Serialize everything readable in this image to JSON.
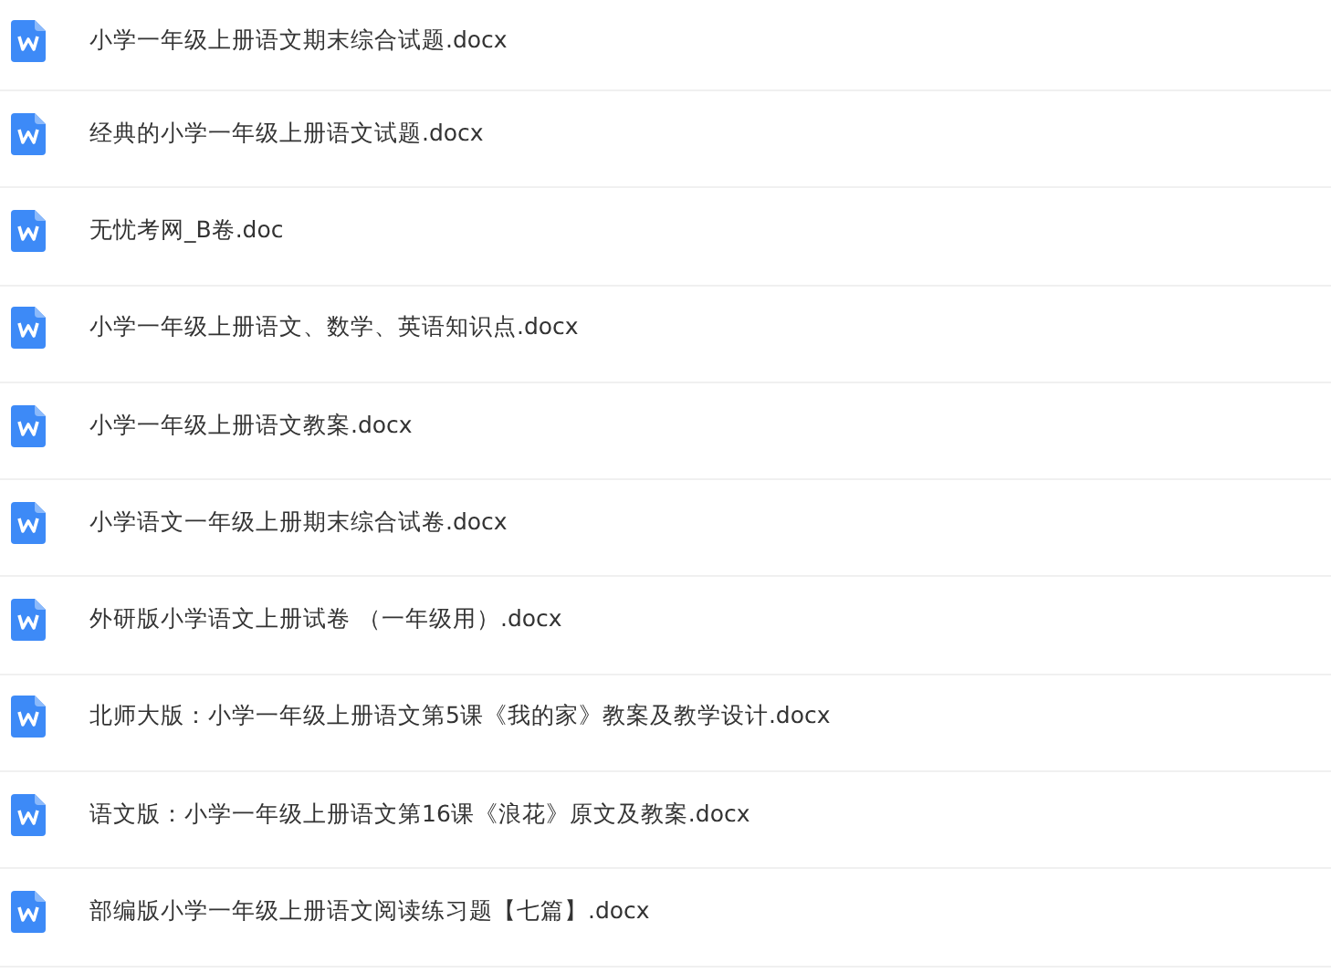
{
  "files": [
    {
      "name": "小学一年级上册语文期末综合试题.docx"
    },
    {
      "name": "经典的小学一年级上册语文试题.docx"
    },
    {
      "name": "无忧考网_B卷.doc"
    },
    {
      "name": "小学一年级上册语文、数学、英语知识点.docx"
    },
    {
      "name": "小学一年级上册语文教案.docx"
    },
    {
      "name": "小学语文一年级上册期末综合试卷.docx"
    },
    {
      "name": "外研版小学语文上册试卷 （一年级用）.docx"
    },
    {
      "name": "北师大版：小学一年级上册语文第5课《我的家》教案及教学设计.docx"
    },
    {
      "name": "语文版：小学一年级上册语文第16课《浪花》原文及教案.docx"
    },
    {
      "name": "部编版小学一年级上册语文阅读练习题【七篇】.docx"
    }
  ]
}
